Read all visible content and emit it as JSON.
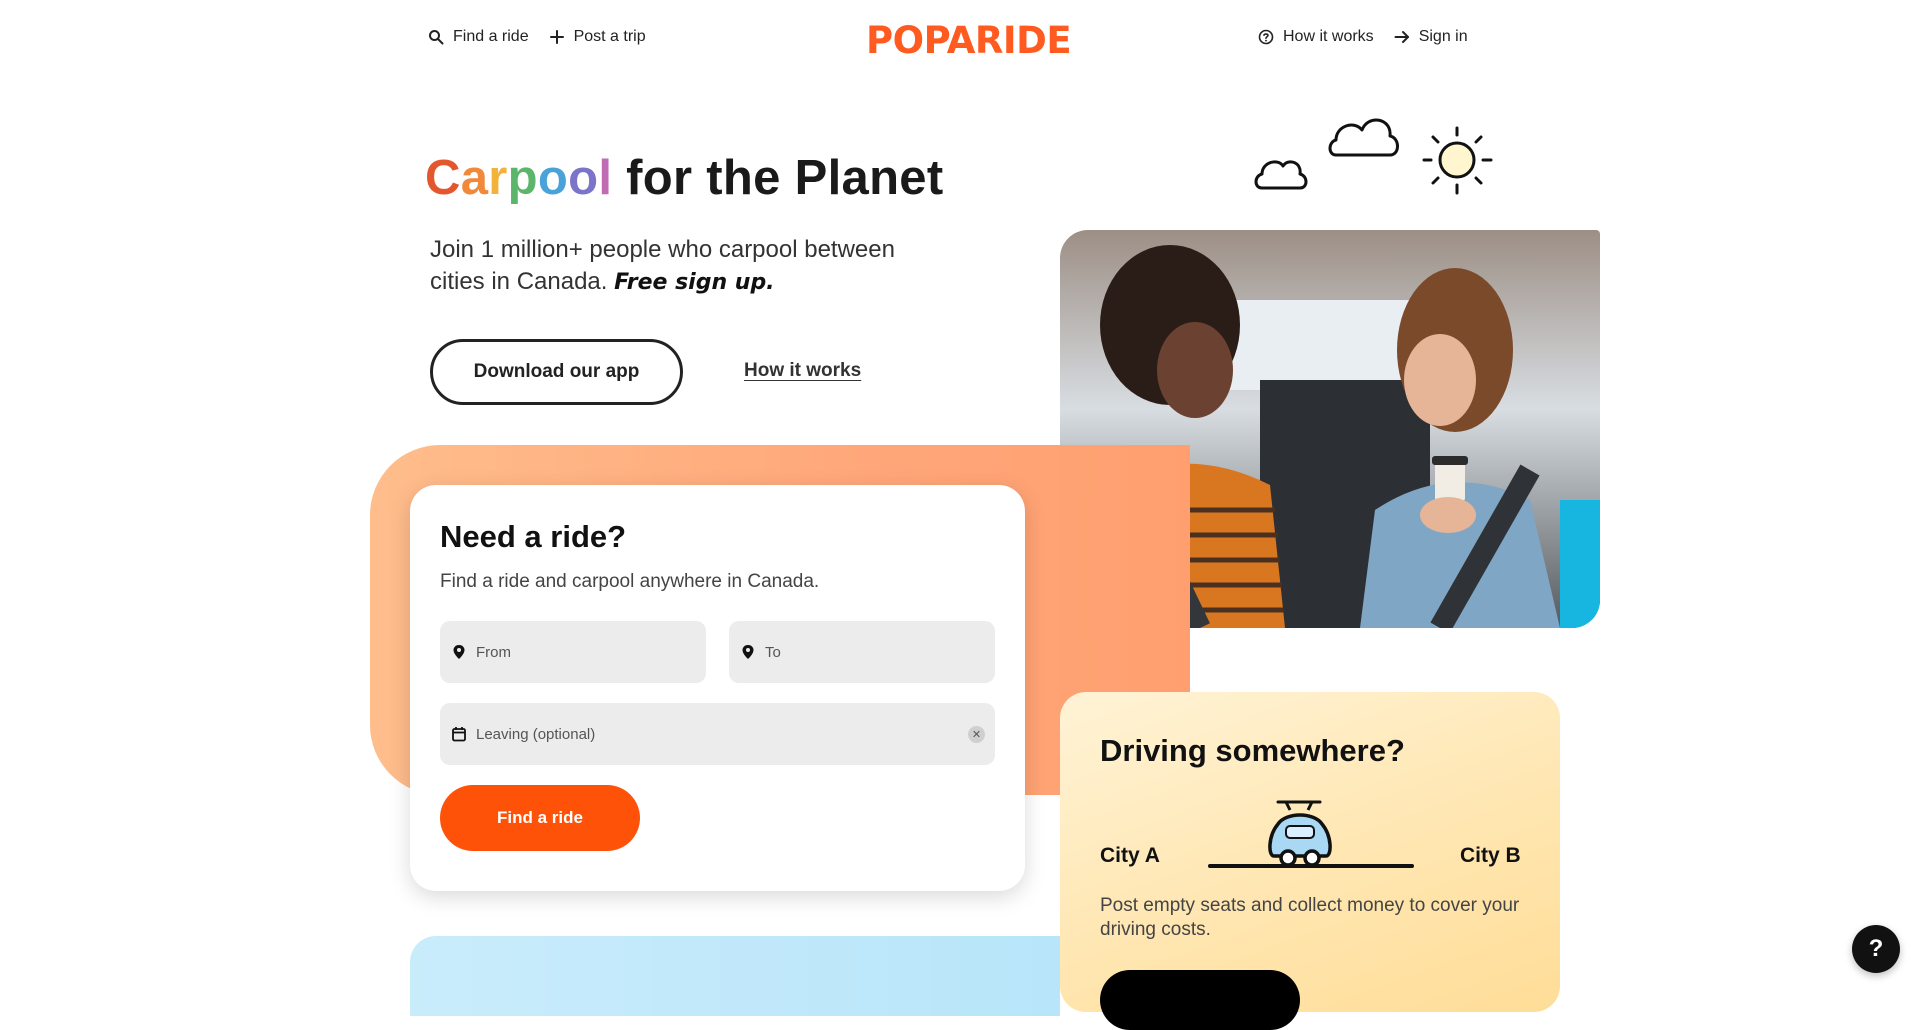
{
  "nav": {
    "find_ride": "Find a ride",
    "post_trip": "Post a trip",
    "how_it_works": "How it works",
    "sign_in": "Sign in"
  },
  "logo": "POPARIDE",
  "hero": {
    "title_colored": [
      "C",
      "a",
      "r",
      "p",
      "o",
      "o",
      "l"
    ],
    "title_colors": [
      "#e4572e",
      "#f0893a",
      "#f2b33d",
      "#5bb56a",
      "#4aa3d8",
      "#7b74c9",
      "#c06bb4"
    ],
    "title_rest": "for the Planet",
    "subtitle": "Join 1 million+ people who carpool between cities in Canada.",
    "subtitle_emphasis": "Free sign up.",
    "download_button": "Download our app",
    "how_link": "How it works"
  },
  "ride_card": {
    "title": "Need a ride?",
    "subtitle": "Find a ride and carpool anywhere in Canada.",
    "from_placeholder": "From",
    "to_placeholder": "To",
    "leaving_placeholder": "Leaving (optional)",
    "find_button": "Find a ride"
  },
  "drive_card": {
    "title": "Driving somewhere?",
    "city_a": "City A",
    "city_b": "City B",
    "description": "Post empty seats and collect money to cover your driving costs."
  },
  "help": "?",
  "colors": {
    "brand": "#ff5a1f",
    "find_button": "#ff5209",
    "orange_bg": "#ffa77a",
    "drive_bg": "#ffe5ae",
    "blue_bg": "#c9ecfb"
  }
}
